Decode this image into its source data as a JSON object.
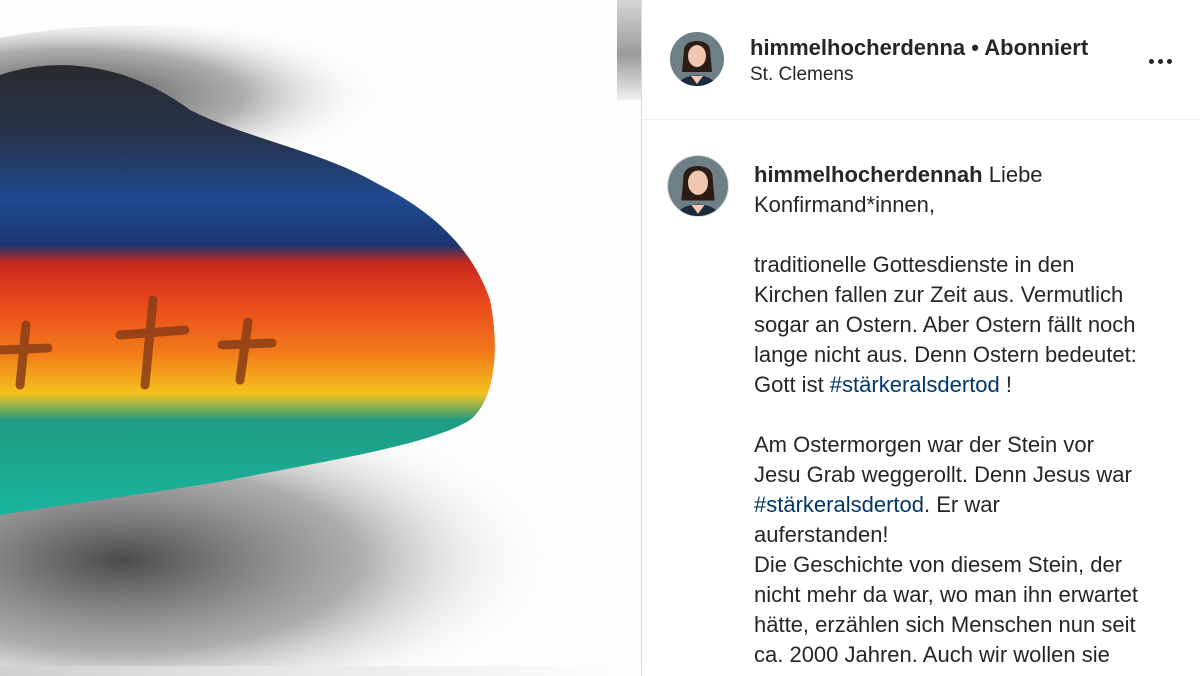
{
  "post": {
    "header": {
      "username": "himmelhocherdenna",
      "separator": " • ",
      "follow_status": "Abonniert",
      "location": "St. Clemens"
    },
    "caption": {
      "username": "himmelhocherdennah",
      "greeting": " Liebe Konfirmand*innen,",
      "p2_line1": "traditionelle Gottesdienste in den",
      "p2_line2": "Kirchen fallen zur Zeit aus. Vermutlich",
      "p2_line3": "sogar an Ostern. Aber Ostern fällt noch",
      "p2_line4": "lange nicht aus. Denn Ostern bedeutet:",
      "p2_line5_pre": "Gott ist ",
      "hashtag": "#stärkeralsdertod",
      "p2_line5_post": " !",
      "p3_line1": "Am Ostermorgen war der Stein vor",
      "p3_line2": "Jesu Grab weggerollt. Denn Jesus war",
      "p3_line3_post": ". Er war",
      "p3_line4": "auferstanden!",
      "p4_line1": "Die Geschichte von diesem Stein, der",
      "p4_line2": "nicht mehr da war, wo man ihn erwartet",
      "p4_line3": "hätte, erzählen sich Menschen nun seit",
      "p4_line4": "ca. 2000 Jahren. Auch wir wollen sie"
    },
    "icons": {
      "more": "more-options-icon"
    }
  }
}
